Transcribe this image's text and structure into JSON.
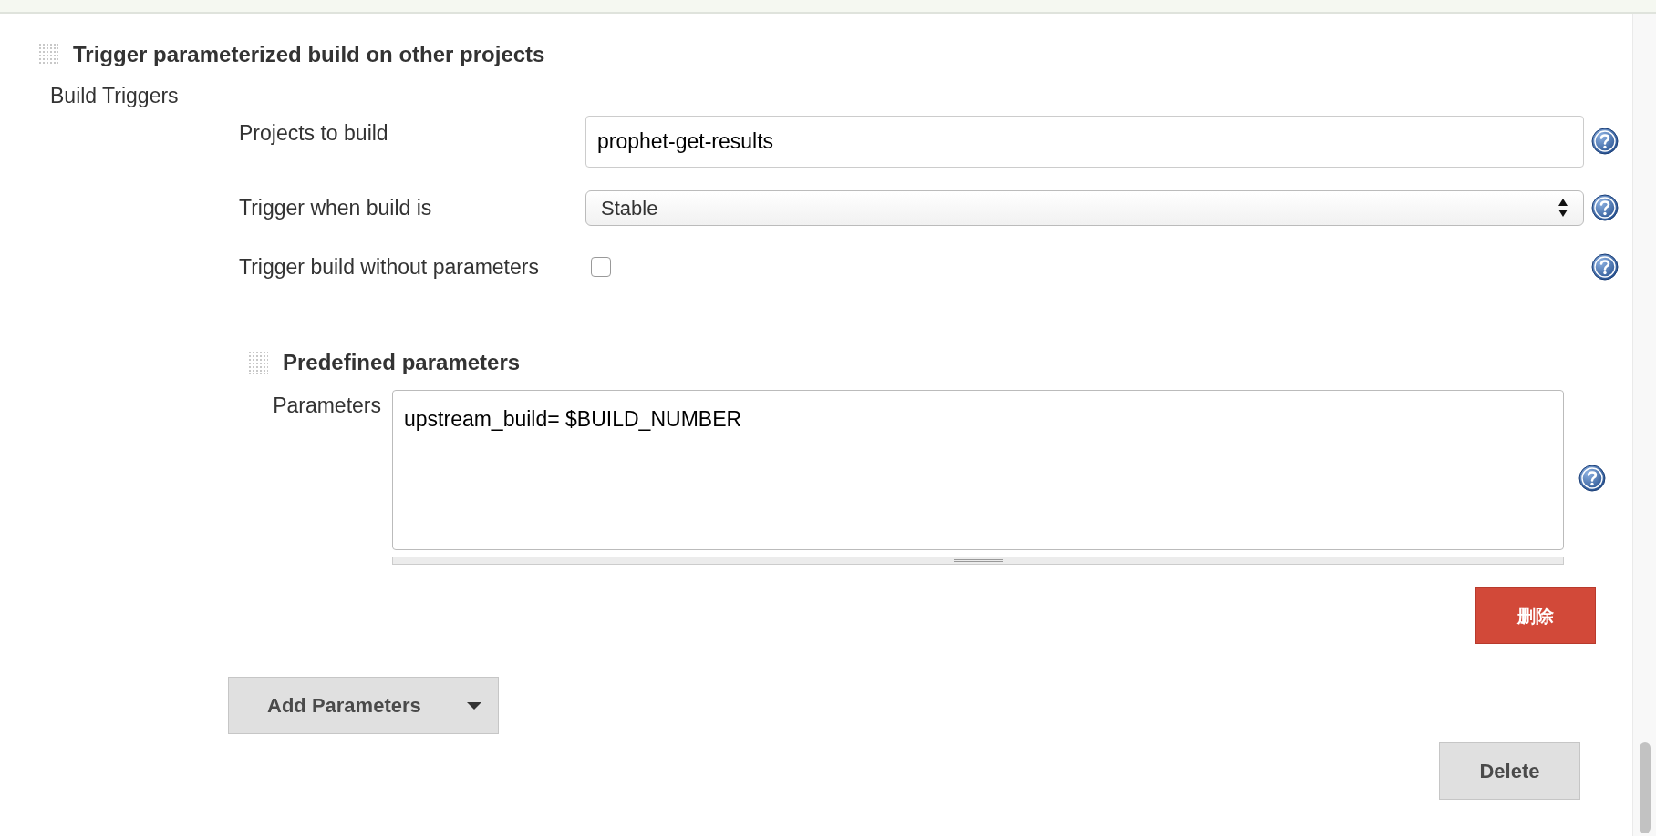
{
  "section": {
    "title": "Trigger parameterized build on other projects",
    "subtitle": "Build Triggers"
  },
  "fields": [
    {
      "kind": "text",
      "label": "Projects to build",
      "value": "prophet-get-results"
    },
    {
      "kind": "select",
      "label": "Trigger when build is",
      "value": "Stable"
    },
    {
      "kind": "checkbox",
      "label": "Trigger build without parameters",
      "checked": false
    }
  ],
  "parameters_block": {
    "title": "Predefined parameters",
    "label": "Parameters",
    "value": "upstream_build= $BUILD_NUMBER",
    "remove_button": "删除"
  },
  "add_button": "Add Parameters",
  "delete_button": "Delete"
}
